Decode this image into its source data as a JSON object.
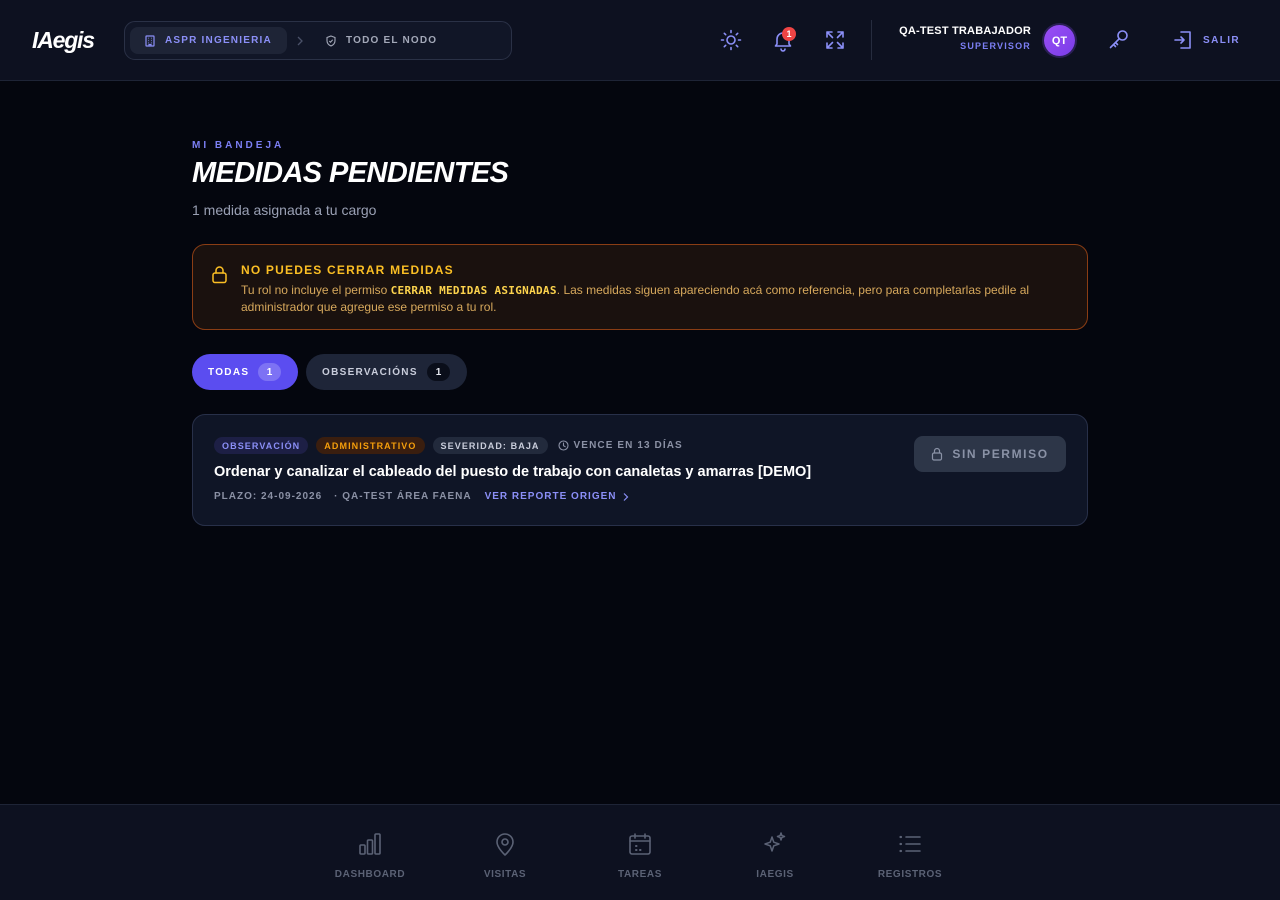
{
  "header": {
    "logo": "IAegis",
    "breadcrumb": {
      "company": "ASPR INGENIERIA",
      "scope": "TODO EL NODO"
    },
    "notifications_count": "1",
    "user": {
      "name": "QA-TEST TRABAJADOR",
      "role": "SUPERVISOR",
      "initials": "QT"
    },
    "logout_label": "SALIR"
  },
  "main": {
    "eyebrow": "MI BANDEJA",
    "title": "MEDIDAS PENDIENTES",
    "subtitle": "1 medida asignada a tu cargo",
    "alert": {
      "title": "NO PUEDES CERRAR MEDIDAS",
      "body_before": "Tu rol no incluye el permiso ",
      "permission": "CERRAR MEDIDAS ASIGNADAS",
      "body_after": ". Las medidas siguen apareciendo acá como referencia, pero para completarlas pedile al administrador que agregue ese permiso a tu rol."
    },
    "filters": [
      {
        "label": "TODAS",
        "count": "1",
        "active": true
      },
      {
        "label": "OBSERVACIÓNS",
        "count": "1",
        "active": false
      }
    ],
    "items": [
      {
        "tags": {
          "type": "OBSERVACIÓN",
          "category": "ADMINISTRATIVO",
          "severity": "SEVERIDAD: BAJA"
        },
        "due": "VENCE EN 13 DÍAS",
        "title": "Ordenar y canalizar el cableado del puesto de trabajo con canaletas y amarras [DEMO]",
        "deadline": "PLAZO: 24-09-2026",
        "area": "· QA-TEST ÁREA FAENA",
        "link": "VER REPORTE ORIGEN",
        "action": "SIN PERMISO"
      }
    ]
  },
  "bottom_nav": [
    {
      "label": "DASHBOARD",
      "icon": "bar-chart-icon"
    },
    {
      "label": "VISITAS",
      "icon": "map-pin-icon"
    },
    {
      "label": "TAREAS",
      "icon": "calendar-icon"
    },
    {
      "label": "IAEGIS",
      "icon": "sparkles-icon"
    },
    {
      "label": "REGISTROS",
      "icon": "list-icon"
    }
  ],
  "colors": {
    "accent": "#5b4df0",
    "accent_text": "#8b8ff7",
    "warning": "#fbbf24",
    "danger": "#ef4444",
    "background": "#04060e"
  }
}
